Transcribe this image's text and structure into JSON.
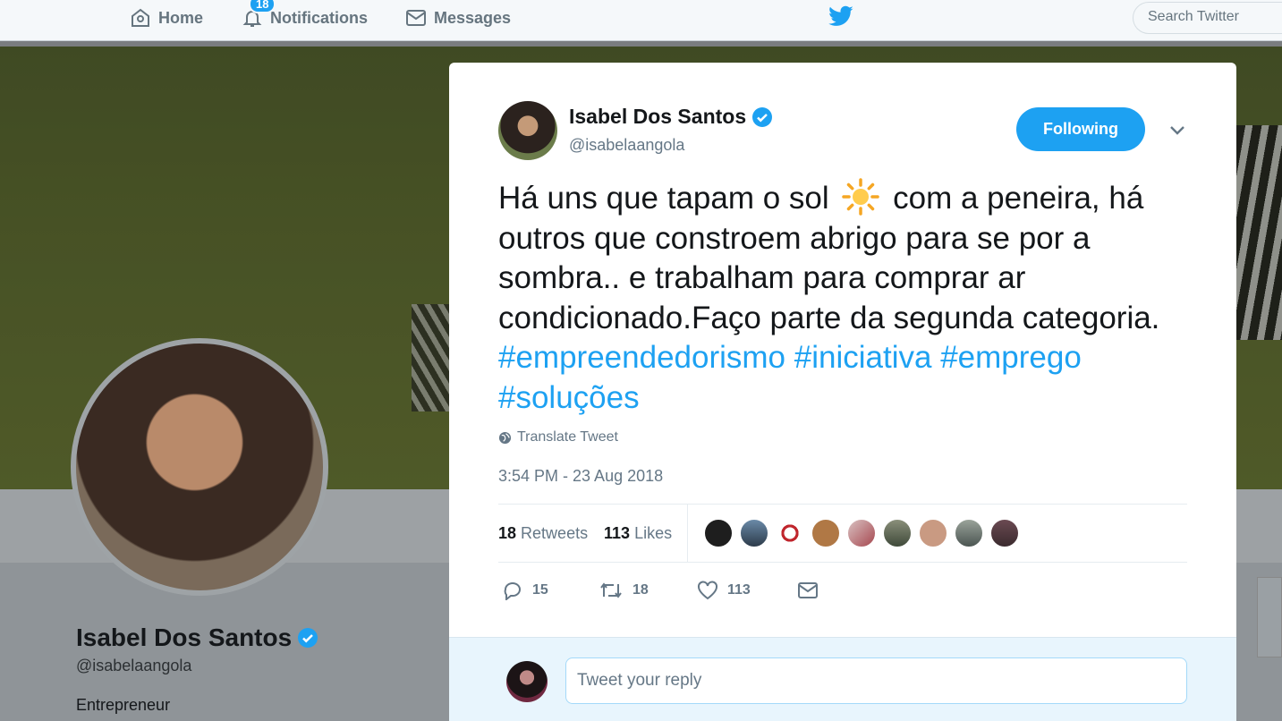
{
  "nav": {
    "home_label": "Home",
    "notifications_label": "Notifications",
    "notifications_badge": "18",
    "messages_label": "Messages",
    "search_placeholder": "Search Twitter"
  },
  "profile": {
    "name": "Isabel Dos Santos",
    "handle": "@isabelaangola",
    "bio": "Entrepreneur"
  },
  "tweet": {
    "author_name": "Isabel Dos Santos",
    "author_handle": "@isabelaangola",
    "follow_label": "Following",
    "text_part1": "Há uns que tapam o sol",
    "text_part2": "com a peneira, há outros que constroem abrigo para se por a sombra.. e trabalham para comprar ar condicionado.Faço parte da segunda categoria.",
    "hashtag1": "#empreendedorismo",
    "hashtag2": "#iniciativa",
    "hashtag3": "#emprego",
    "hashtag4": "#soluções",
    "translate_label": "Translate Tweet",
    "timestamp": "3:54 PM - 23 Aug 2018",
    "retweets_count": "18",
    "retweets_label": "Retweets",
    "likes_count": "113",
    "likes_label": "Likes",
    "reply_count": "15",
    "retweet_action_count": "18",
    "like_action_count": "113",
    "reply_placeholder": "Tweet your reply"
  },
  "colors": {
    "accent": "#1da1f2",
    "text": "#14171a",
    "muted": "#657786"
  }
}
